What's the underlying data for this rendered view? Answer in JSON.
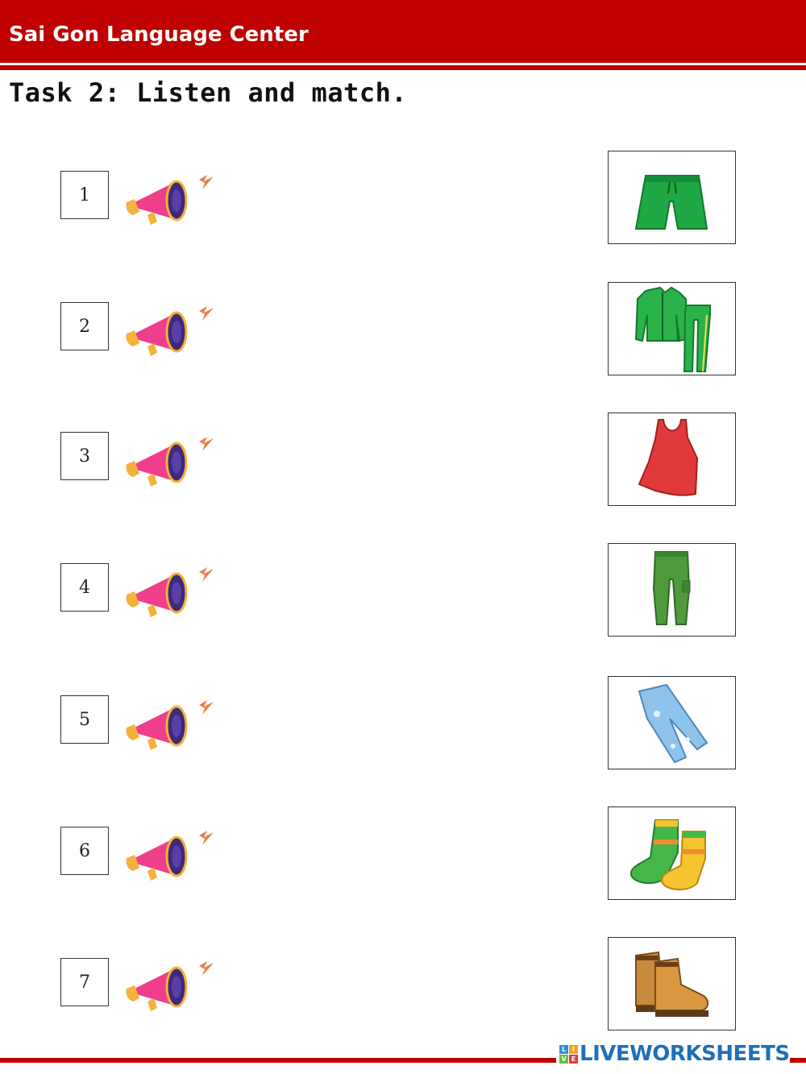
{
  "header": {
    "title": "Sai Gon Language Center"
  },
  "task": {
    "title": "Task 2: Listen and match."
  },
  "items": [
    {
      "number": "1",
      "audio_icon": "megaphone-icon",
      "picture": "green-shorts"
    },
    {
      "number": "2",
      "audio_icon": "megaphone-icon",
      "picture": "green-tracksuit"
    },
    {
      "number": "3",
      "audio_icon": "megaphone-icon",
      "picture": "red-tank-top"
    },
    {
      "number": "4",
      "audio_icon": "megaphone-icon",
      "picture": "green-cargo-pants"
    },
    {
      "number": "5",
      "audio_icon": "megaphone-icon",
      "picture": "blue-jeans"
    },
    {
      "number": "6",
      "audio_icon": "megaphone-icon",
      "picture": "striped-socks"
    },
    {
      "number": "7",
      "audio_icon": "megaphone-icon",
      "picture": "brown-boots"
    }
  ],
  "footer": {
    "logo_text": "LIVEWORKSHEETS",
    "logo_mark": [
      "L",
      "I",
      "V",
      "E"
    ]
  },
  "colors": {
    "brand_red": "#c00000",
    "logo_blue": "#1f6fb8"
  }
}
